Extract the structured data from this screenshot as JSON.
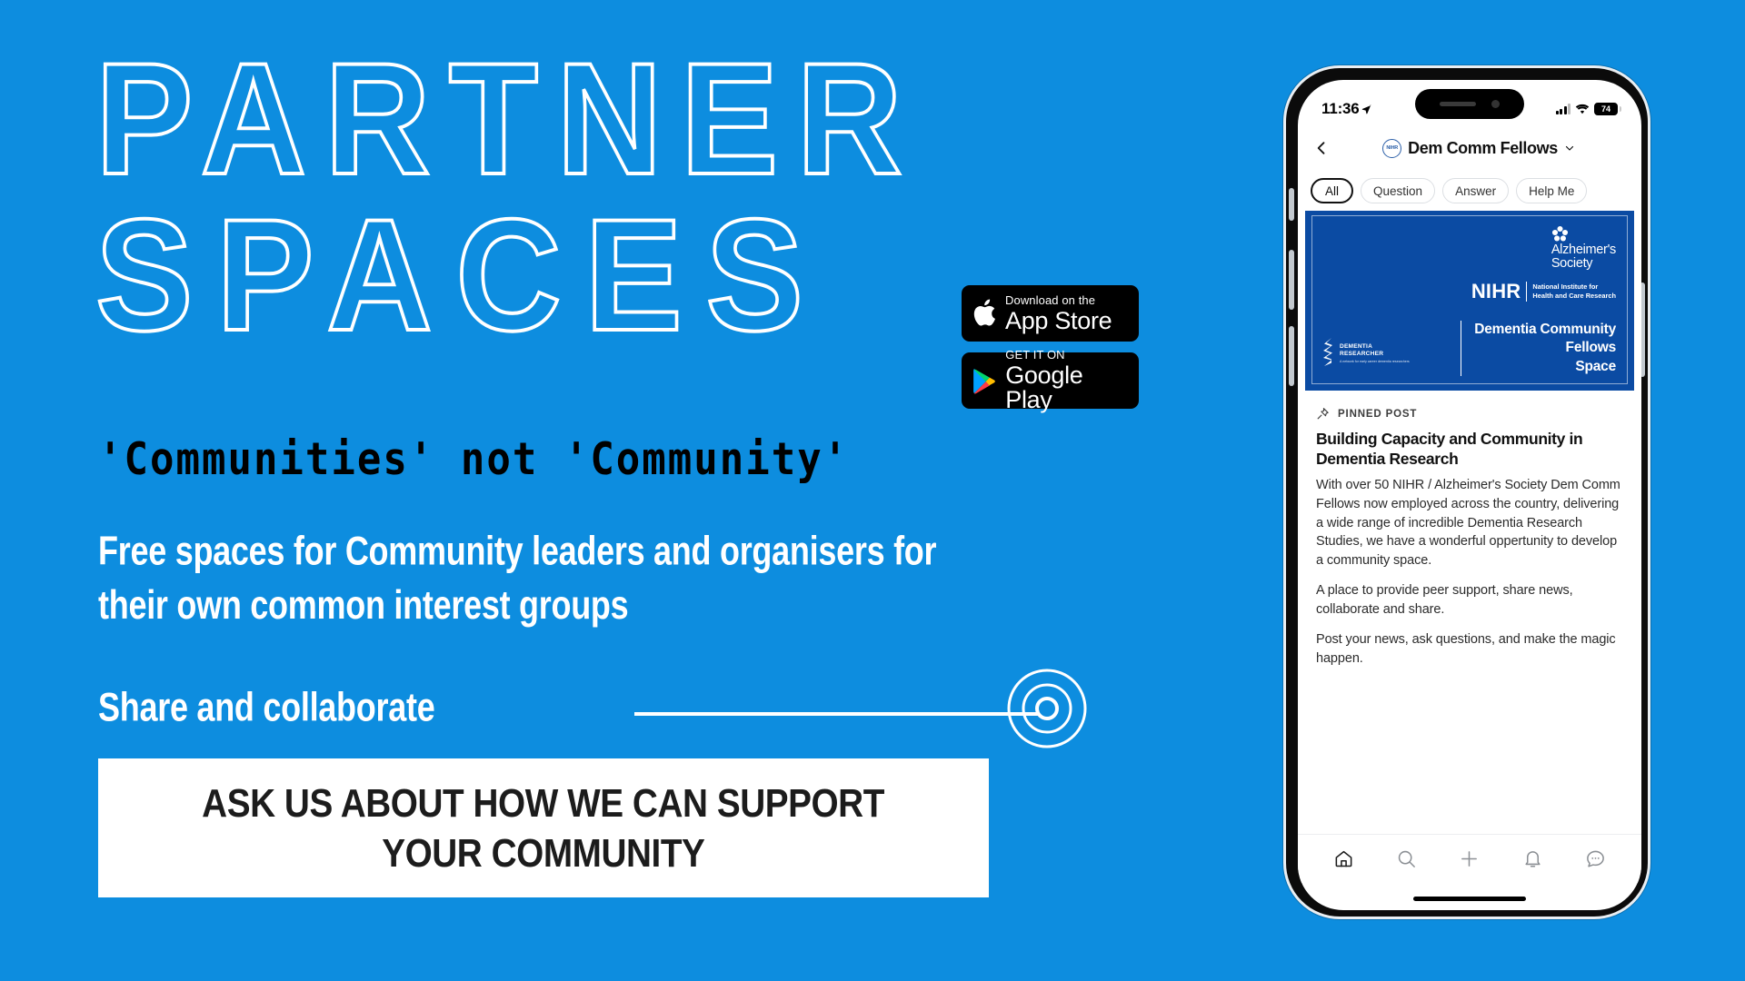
{
  "theme": {
    "background": "#0d8ddf",
    "banner_blue": "#0b4ba3",
    "cta_background": "#ffffff",
    "text_white": "#ffffff",
    "text_black": "#000000"
  },
  "hero": {
    "line1": "PARTNER",
    "line2": "SPACES"
  },
  "quote": "'Communities' not 'Community'",
  "lede": "Free spaces for Community leaders and organisers for their own common interest groups",
  "share": {
    "label": "Share and collaborate",
    "target_icon": "target-icon"
  },
  "cta": {
    "line1": "ASK US ABOUT HOW WE CAN SUPPORT",
    "line2": "YOUR COMMUNITY"
  },
  "badges": [
    {
      "icon": "apple-icon",
      "small": "Download on the",
      "big": "App Store"
    },
    {
      "icon": "google-play-icon",
      "small": "GET IT ON",
      "big": "Google Play"
    }
  ],
  "phone": {
    "status_bar": {
      "time": "11:36",
      "location_icon": "location-arrow-icon",
      "signal_icon": "cellular-bars-icon",
      "wifi_icon": "wifi-icon",
      "battery_level": "74"
    },
    "header": {
      "back_icon": "chevron-left-icon",
      "avatar_label": "NIHR",
      "title": "Dem Comm Fellows",
      "chevron_icon": "chevron-down-icon"
    },
    "chips": [
      {
        "label": "All",
        "active": true
      },
      {
        "label": "Question",
        "active": false
      },
      {
        "label": "Answer",
        "active": false
      },
      {
        "label": "Help Me",
        "active": false
      }
    ],
    "banner": {
      "alzheimers_line1": "Alzheimer's",
      "alzheimers_line2": "Society",
      "nihr_word": "NIHR",
      "nihr_sub_line1": "National Institute for",
      "nihr_sub_line2": "Health and Care Research",
      "title_line1": "Dementia Community",
      "title_line2": "Fellows",
      "title_line3": "Space",
      "dr_line1": "DEMENTIA",
      "dr_line2": "RESEARCHER",
      "dr_line3": "A network for early career dementia researchers"
    },
    "post": {
      "pinned_icon": "pin-icon",
      "pinned_label": "PINNED POST",
      "title": "Building Capacity and Community in Dementia Research",
      "paragraphs": [
        "With over 50 NIHR / Alzheimer's Society Dem Comm Fellows now employed across the country, delivering a wide range of incredible Dementia Research Studies, we have a wonderful oppertunity to develop a community space.",
        "A place to provide peer support, share news, collaborate and share.",
        "Post your news, ask questions, and make the magic happen."
      ]
    },
    "tab_bar": [
      {
        "icon": "home-icon"
      },
      {
        "icon": "search-icon"
      },
      {
        "icon": "plus-icon"
      },
      {
        "icon": "bell-icon"
      },
      {
        "icon": "chat-bubble-icon"
      }
    ]
  }
}
